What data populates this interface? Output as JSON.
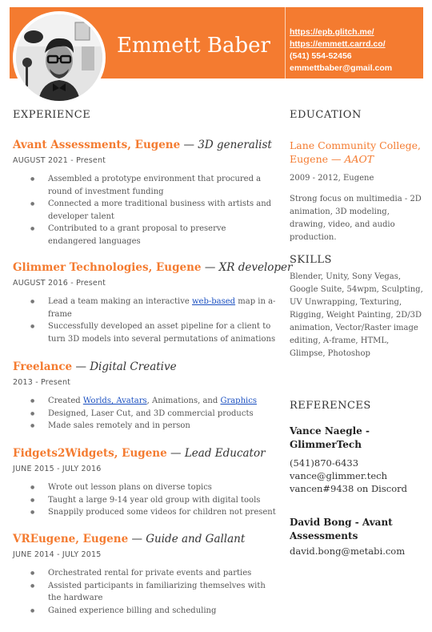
{
  "header": {
    "name": "Emmett Baber",
    "contact": {
      "link1": "https://epb.glitch.me/",
      "link2": "https://emmett.carrd.co/",
      "phone": "(541) 554-52456",
      "email": "emmettbaber@gmail.com"
    }
  },
  "sections": {
    "experience": "EXPERIENCE",
    "education": "EDUCATION",
    "skills": "SKILLS",
    "references": "REFERENCES"
  },
  "jobs": [
    {
      "org": "Avant Assessments, Eugene",
      "role": "3D generalist",
      "date": "AUGUST 2021 - Present",
      "bullets": [
        "Assembled a prototype environment that procured a round of investment funding",
        "Connected a more traditional business with artists and developer talent",
        "Contributed to a grant proposal to preserve endangered languages"
      ]
    },
    {
      "org": "Glimmer Technologies, Eugene",
      "role": "XR developer",
      "date": "AUGUST 2016 - Present",
      "b1_pre": "Lead a team making an interactive ",
      "b1_link": "web-based",
      "b1_post": " map in a-frame",
      "b2": "Successfully developed an asset pipeline for a client to turn 3D models into several permutations of animations"
    },
    {
      "org": "Freelance",
      "role": "Digital Creative",
      "date": "2013 - Present",
      "b1_pre": "Created ",
      "b1_link1": "Worlds, Avatars",
      "b1_mid": ", Animations, and ",
      "b1_link2": "Graphics",
      "b2": "Designed, Laser Cut, and 3D commercial products",
      "b3": "Made sales remotely and in person"
    },
    {
      "org": "Fidgets2Widgets, Eugene",
      "role": "Lead Educator",
      "date": "JUNE 2015 - JULY 2016",
      "bullets": [
        "Wrote out lesson plans on diverse topics",
        "Taught a large 9-14 year old group with digital tools",
        "Snappily produced some videos for children not present"
      ]
    },
    {
      "org": "VREugene, Eugene",
      "role": "Guide and Gallant",
      "date": "JUNE 2014 - JULY 2015",
      "bullets": [
        "Orchestrated rental for private events and parties",
        "Assisted participants in familiarizing themselves with the hardware",
        "Gained experience billing and scheduling"
      ]
    }
  ],
  "education": {
    "school": "Lane Community College, Eugene",
    "degree": "AAOT",
    "date": "2009 - 2012, Eugene",
    "description": "Strong focus on multimedia - 2D animation, 3D modeling, drawing, video, and audio production."
  },
  "skills": "Blender, Unity, Sony Vegas, Google Suite,  54wpm, Sculpting, UV Unwrapping, Texturing, Rigging, Weight Painting, 2D/3D animation, Vector/Raster image editing, A-frame, HTML, Glimpse, Photoshop",
  "references": [
    {
      "name": "Vance Naegle - GlimmerTech",
      "lines": [
        "(541)870-6433",
        "vance@glimmer.tech",
        "vancen#9438 on Discord"
      ]
    },
    {
      "name": "David Bong - Avant Assessments",
      "lines": [
        "david.bong@metabi.com"
      ]
    }
  ]
}
